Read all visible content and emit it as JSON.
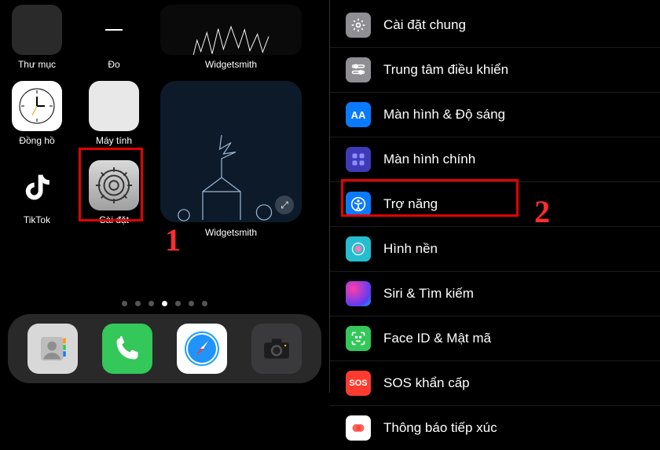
{
  "annotations": {
    "step1": "1",
    "step2": "2"
  },
  "homescreen": {
    "row1": {
      "folder": "Thư mục",
      "measure": "Đo",
      "widgetsmith": "Widgetsmith"
    },
    "row2": {
      "clock": "Đồng hồ",
      "calculator": "Máy tính"
    },
    "row3": {
      "tiktok": "TikTok",
      "settings": "Cài đặt",
      "widgetsmith_big": "Widgetsmith"
    },
    "page_dots_total": 7,
    "page_dots_active_index": 3
  },
  "dock": {
    "contacts": "Contacts",
    "phone": "Phone",
    "safari": "Safari",
    "camera": "Camera"
  },
  "settings_list": {
    "general": "Cài đặt chung",
    "control_center": "Trung tâm điều khiển",
    "display_label_icon": "AA",
    "display": "Màn hình & Độ sáng",
    "homescreen": "Màn hình chính",
    "accessibility": "Trợ năng",
    "wallpaper": "Hình nền",
    "siri": "Siri & Tìm kiếm",
    "faceid": "Face ID & Mật mã",
    "sos_icon": "SOS",
    "sos": "SOS khẩn cấp",
    "exposure": "Thông báo tiếp xúc"
  }
}
